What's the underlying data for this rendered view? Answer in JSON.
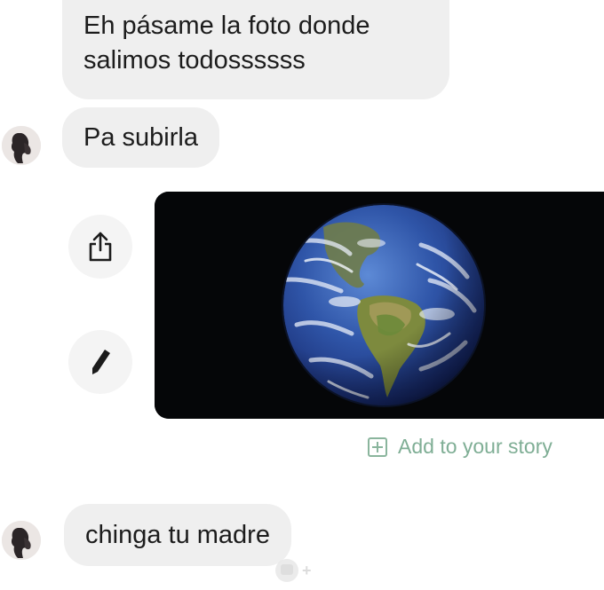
{
  "messages": [
    {
      "lines": [
        "Eh pásame la foto donde",
        "salimos todossssss"
      ]
    },
    {
      "text": "Pa subirla"
    },
    {
      "text": "chinga tu madre"
    }
  ],
  "actions": {
    "share_icon": "share-icon",
    "edit_icon": "pencil-icon"
  },
  "photo": {
    "subject": "earth-from-space",
    "icon": "earth-image"
  },
  "add_story": {
    "label": "Add to your story",
    "icon": "plus-square-icon"
  },
  "reaction": {
    "icon": "add-reaction-icon"
  },
  "colors": {
    "bubble": "#efefef",
    "text": "#1c1c1c",
    "add_story": "#7fae95",
    "photo_background": "#050608"
  }
}
